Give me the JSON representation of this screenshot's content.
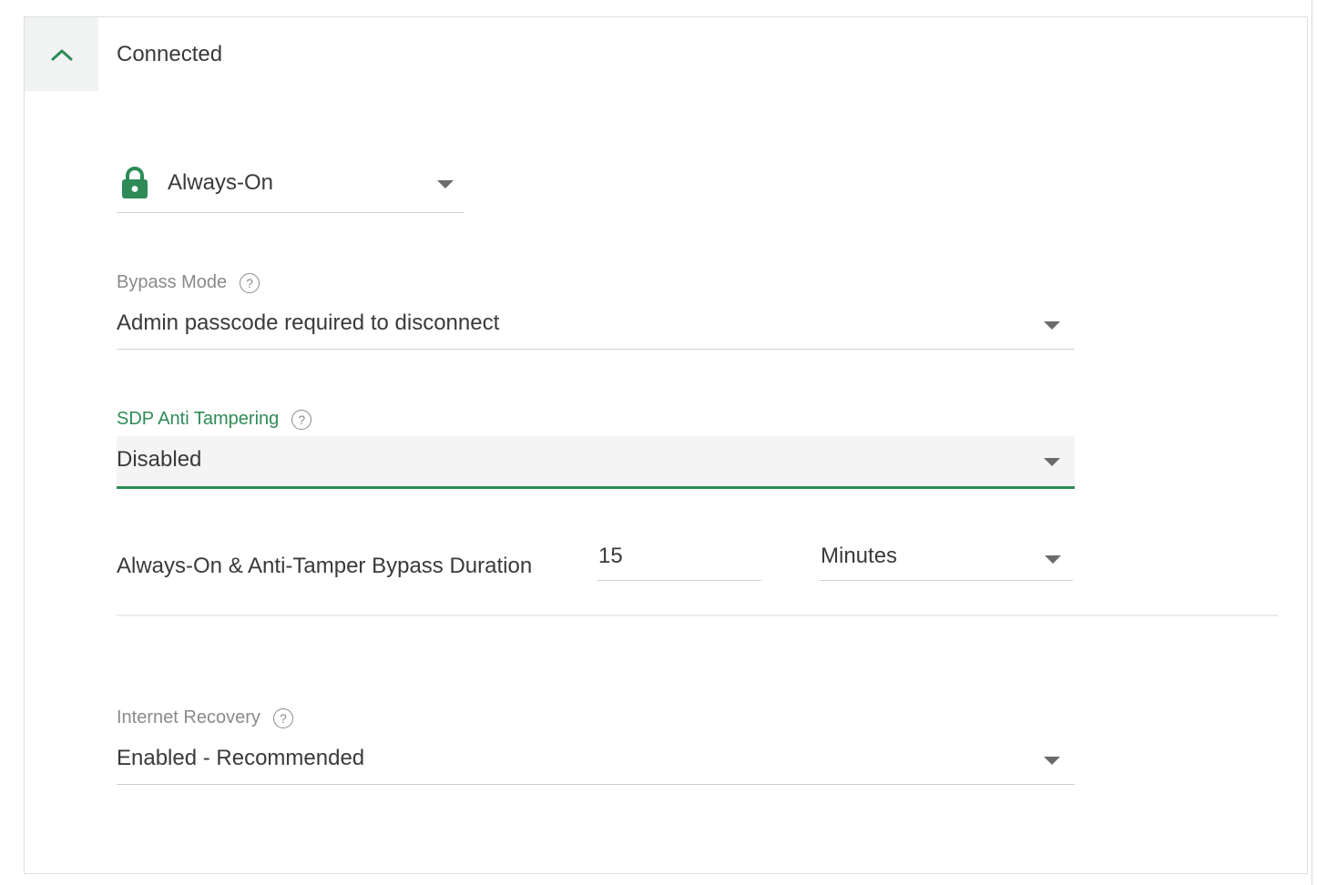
{
  "section": {
    "title": "Connected",
    "collapse_icon": "chevron-up-icon"
  },
  "mode": {
    "icon": "lock-icon",
    "value": "Always-On"
  },
  "bypass_mode": {
    "label": "Bypass Mode",
    "help": "?",
    "value": "Admin passcode required to disconnect"
  },
  "anti_tampering": {
    "label": "SDP Anti Tampering",
    "help": "?",
    "value": "Disabled"
  },
  "bypass_duration": {
    "label": "Always-On & Anti-Tamper Bypass Duration",
    "value": "15",
    "unit": "Minutes"
  },
  "internet_recovery": {
    "label": "Internet Recovery",
    "help": "?",
    "value": "Enabled - Recommended"
  },
  "colors": {
    "accent": "#2e8b57",
    "label_gray": "#8a8a8a",
    "text": "#3a3a3a"
  }
}
